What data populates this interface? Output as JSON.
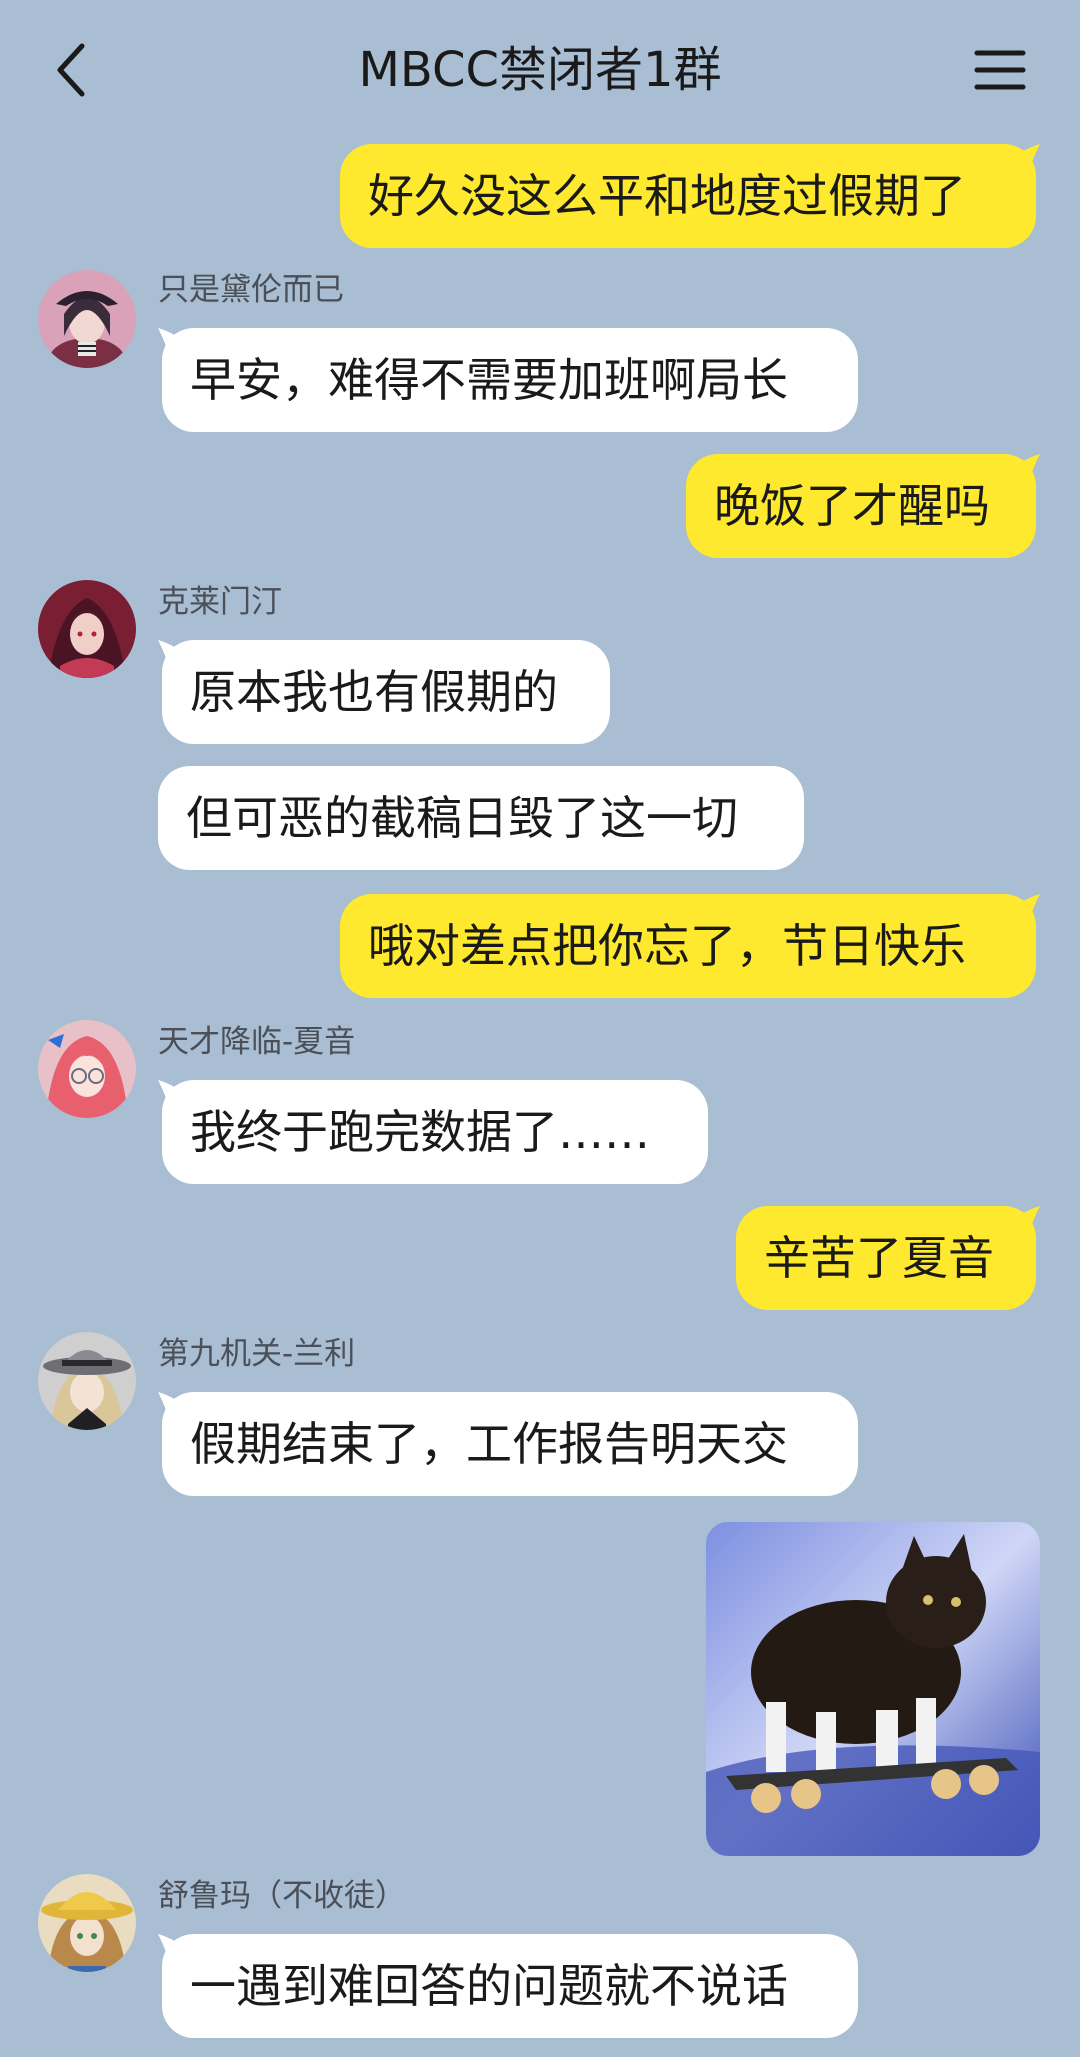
{
  "header": {
    "title": "MBCC禁闭者1群",
    "back_icon": "chevron-left-icon",
    "menu_icon": "hamburger-menu-icon"
  },
  "colors": {
    "background": "#a9bdd3",
    "self_bubble": "#ffe92e",
    "other_bubble": "#ffffff"
  },
  "messages": [
    {
      "from": "self",
      "text": "好久没这么平和地度过假期了"
    },
    {
      "from": "只是黛伦而已",
      "text": "早安，难得不需要加班啊局长"
    },
    {
      "from": "self",
      "text": "晚饭了才醒吗"
    },
    {
      "from": "克莱门汀",
      "text": "原本我也有假期的"
    },
    {
      "from": "克莱门汀",
      "text": "但可恶的截稿日毁了这一切"
    },
    {
      "from": "self",
      "text": "哦对差点把你忘了，节日快乐"
    },
    {
      "from": "天才降临-夏音",
      "text": "我终于跑完数据了……"
    },
    {
      "from": "self",
      "text": "辛苦了夏音"
    },
    {
      "from": "第九机关-兰利",
      "text": "假期结束了，工作报告明天交"
    },
    {
      "from": "self",
      "image": "cat-on-skateboard-sticker"
    },
    {
      "from": "舒鲁玛（不收徒）",
      "text": "一遇到难回答的问题就不说话"
    }
  ],
  "senders": [
    "只是黛伦而已",
    "克莱门汀",
    "天才降临-夏音",
    "第九机关-兰利",
    "舒鲁玛（不收徒）"
  ]
}
